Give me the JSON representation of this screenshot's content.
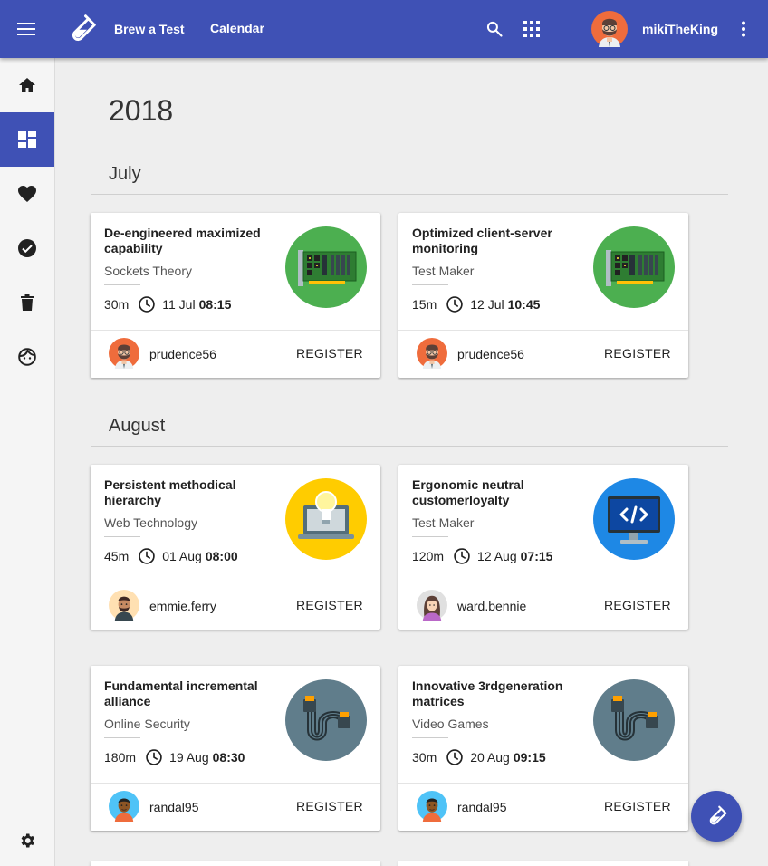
{
  "header": {
    "nav": [
      "Brew a Test",
      "Calendar"
    ],
    "user_name": "mikiTheKing"
  },
  "sidebar": {
    "items": [
      "home-icon",
      "dashboard-icon",
      "heart-icon",
      "check-circle-icon",
      "trash-icon",
      "face-icon"
    ],
    "bottom": "gear-icon",
    "active_index": 1
  },
  "main": {
    "year": "2018",
    "months": [
      {
        "name": "July",
        "cards": [
          {
            "title": "De-engineered maximized capability",
            "category": "Sockets Theory",
            "duration": "30m",
            "date": "11 Jul",
            "time": "08:15",
            "owner": "prudence56",
            "action": "REGISTER",
            "image": "circuit-board"
          },
          {
            "title": "Optimized client-server monitoring",
            "category": "Test Maker",
            "duration": "15m",
            "date": "12 Jul",
            "time": "10:45",
            "owner": "prudence56",
            "action": "REGISTER",
            "image": "circuit-board"
          }
        ]
      },
      {
        "name": "August",
        "cards": [
          {
            "title": "Persistent methodical hierarchy",
            "category": "Web Technology",
            "duration": "45m",
            "date": "01 Aug",
            "time": "08:00",
            "owner": "emmie.ferry",
            "action": "REGISTER",
            "image": "laptop-idea"
          },
          {
            "title": "Ergonomic neutral customerloyalty",
            "category": "Test Maker",
            "duration": "120m",
            "date": "12 Aug",
            "time": "07:15",
            "owner": "ward.bennie",
            "action": "REGISTER",
            "image": "code-monitor"
          },
          {
            "title": "Fundamental incremental alliance",
            "category": "Online Security",
            "duration": "180m",
            "date": "19 Aug",
            "time": "08:30",
            "owner": "randal95",
            "action": "REGISTER",
            "image": "cables"
          },
          {
            "title": "Innovative 3rdgeneration matrices",
            "category": "Video Games",
            "duration": "30m",
            "date": "20 Aug",
            "time": "09:15",
            "owner": "randal95",
            "action": "REGISTER",
            "image": "cables"
          }
        ]
      }
    ]
  },
  "colors": {
    "primary": "#3f51b5",
    "green": "#4caf50",
    "yellow": "#ffcc00",
    "blue": "#1e88e5",
    "slate": "#607d8b"
  }
}
